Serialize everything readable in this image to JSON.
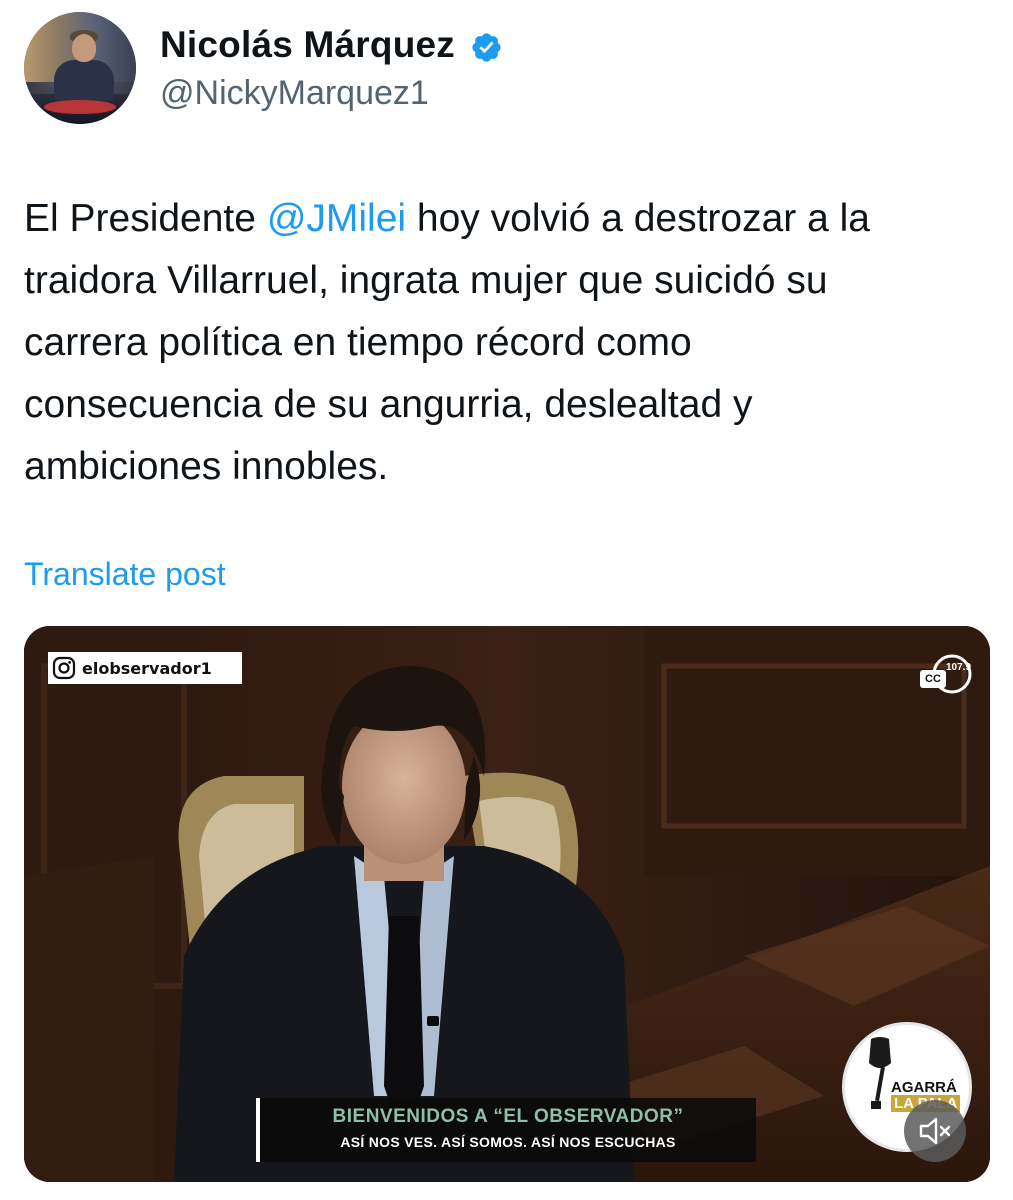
{
  "author": {
    "name": "Nicolás Márquez",
    "handle": "@NickyMarquez1",
    "verified": true,
    "verified_color": "#1d9bf0"
  },
  "post": {
    "lines": [
      {
        "before": "El Presidente ",
        "mention": "@JMilei",
        "after": " hoy volvió a destrozar a la"
      },
      {
        "text": "traidora Villarruel, ingrata mujer que suicidó su"
      },
      {
        "text": "carrera política en tiempo récord como"
      },
      {
        "text": "consecuencia de su angurria, deslealtad y"
      },
      {
        "text": "ambiciones innobles."
      }
    ],
    "mention_color": "#1d9bf0",
    "translate_label": "Translate post"
  },
  "media": {
    "instagram_tag": "elobservador1",
    "cc_label": "CC",
    "frequency_label": "107.9",
    "lower_third_title": "BIENVENIDOS A “EL OBSERVADOR”",
    "lower_third_subtitle": "ASÍ NOS VES. ASÍ SOMOS. ASÍ NOS ESCUCHAS",
    "logo_line1": "AGARRÁ",
    "logo_line2": "LA PALA",
    "mute_icon": "speaker-muted-icon"
  }
}
